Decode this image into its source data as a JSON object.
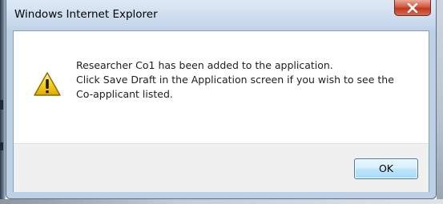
{
  "window": {
    "title": "Windows Internet Explorer"
  },
  "dialog": {
    "icon": "warning-triangle-icon",
    "message_lines": [
      "Researcher Co1 has been added to the application.",
      "Click Save Draft in the Application screen if you wish to see the",
      "Co-applicant listed."
    ],
    "ok_label": "OK"
  },
  "colors": {
    "titlebar": "#c8d9ec",
    "close_button": "#c1391e",
    "ok_button_border": "#3c7fb1",
    "warning_yellow": "#f7d21b"
  }
}
